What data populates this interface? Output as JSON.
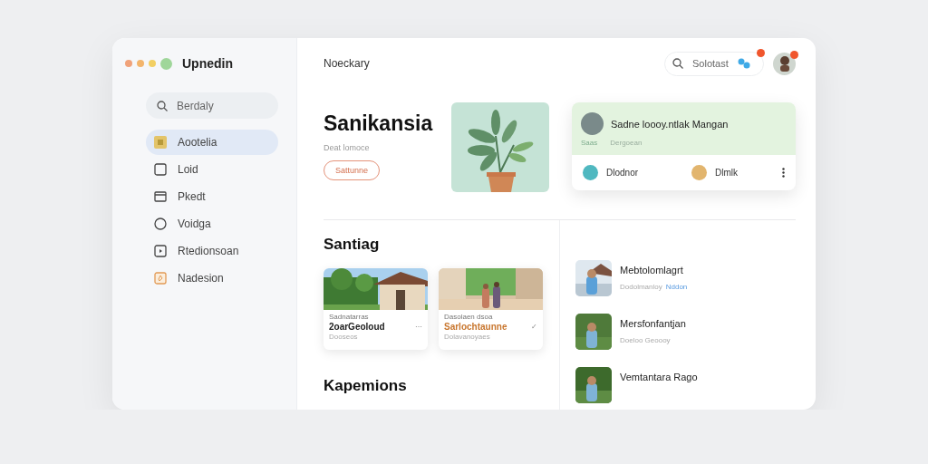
{
  "window": {
    "title": "Upnedin"
  },
  "sidebar": {
    "search": {
      "placeholder": "Berdaly"
    },
    "items": [
      {
        "label": "Aootelia",
        "kind": "grid",
        "selected": true
      },
      {
        "label": "Loid",
        "kind": "square",
        "selected": false
      },
      {
        "label": "Pkedt",
        "kind": "mail",
        "selected": false
      },
      {
        "label": "Voidga",
        "kind": "circle",
        "selected": false
      },
      {
        "label": "Rtedionsoan",
        "kind": "play",
        "selected": false
      },
      {
        "label": "Nadesion",
        "kind": "tag",
        "selected": false
      }
    ]
  },
  "topbar": {
    "title": "Noeckary",
    "search": {
      "placeholder": "Solotast"
    }
  },
  "hero": {
    "title": "Sanikansia",
    "subtitle": "Deat lomoce",
    "button": "Sattunne"
  },
  "featured": {
    "title": "Sadne loooy.ntlak Mangan",
    "tag": "Saas",
    "meta": "Dergoean",
    "actions": [
      {
        "label": "Dlodnor",
        "color": "#4fb8c0"
      },
      {
        "label": "Dlmlk",
        "color": "#e2b56e"
      }
    ]
  },
  "section": {
    "title": "Santiag",
    "cards": [
      {
        "overline": "Sadnatarras",
        "title": "2oarGeoloud",
        "subtitle": "Dooseos",
        "mark": "⋯",
        "color": "#222222"
      },
      {
        "overline": "Dasolaen dsoa",
        "title": "Sarlochtaunne",
        "subtitle": "Dolavanoyaes",
        "mark": "✓",
        "color": "#c8762e"
      }
    ]
  },
  "section2": {
    "title": "Kapemions"
  },
  "list": [
    {
      "title": "Mebtolomlagrt",
      "subtitle": "Dodolmanloy",
      "link": "Nddon"
    },
    {
      "title": "Mersfonfantjan",
      "subtitle": "Doeloo Geoooy"
    },
    {
      "title": "Vemtantara Rago"
    }
  ]
}
